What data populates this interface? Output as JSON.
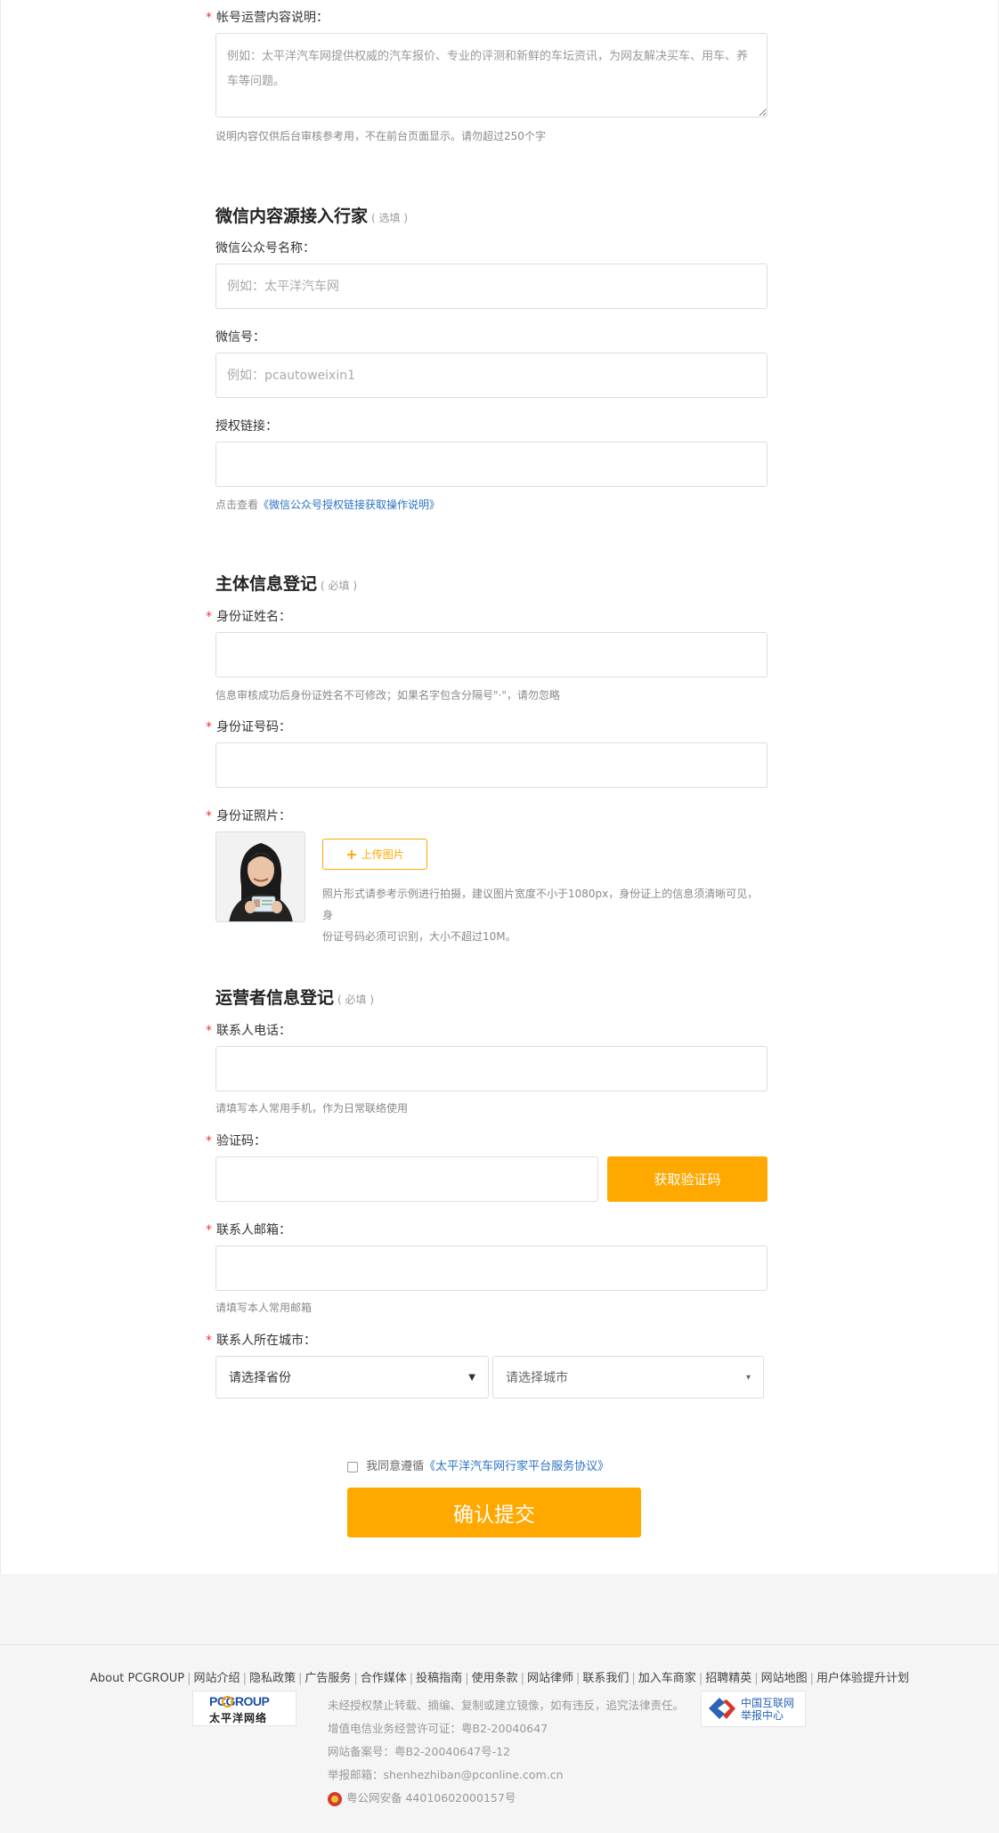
{
  "account_desc": {
    "label": "帐号运营内容说明：",
    "placeholder": "例如：太平洋汽车网提供权威的汽车报价、专业的评测和新鲜的车坛资讯，为网友解决买车、用车、养车等问题。",
    "hint": "说明内容仅供后台审核参考用，不在前台页面显示。请勿超过250个字"
  },
  "wechat": {
    "title": "微信内容源接入行家",
    "note": "( 选填 )",
    "name_label": "微信公众号名称：",
    "name_placeholder": "例如：太平洋汽车网",
    "id_label": "微信号：",
    "id_placeholder": "例如：pcautoweixin1",
    "auth_label": "授权链接：",
    "auth_hint_prefix": "点击查看",
    "auth_hint_link": "《微信公众号授权链接获取操作说明》"
  },
  "subject": {
    "title": "主体信息登记",
    "note": "( 必填 )",
    "idname_label": "身份证姓名：",
    "idname_hint": "信息审核成功后身份证姓名不可修改；如果名字包含分隔号\"·\"，请勿忽略",
    "idnum_label": "身份证号码：",
    "photo_label": "身份证照片：",
    "upload_label": "上传图片",
    "photo_hint_line1": "照片形式请参考示例进行拍摄，建议图片宽度不小于1080px，身份证上的信息须清晰可见，身",
    "photo_hint_line2": "份证号码必须可识别，大小不超过10M。"
  },
  "operator": {
    "title": "运营者信息登记",
    "note": "( 必填 )",
    "phone_label": "联系人电话：",
    "phone_hint": "请填写本人常用手机，作为日常联络使用",
    "code_label": "验证码：",
    "code_button": "获取验证码",
    "email_label": "联系人邮箱：",
    "email_hint": "请填写本人常用邮箱",
    "city_label": "联系人所在城市：",
    "province_select": "请选择省份",
    "city_select": "请选择城市"
  },
  "agreement": {
    "prefix": "我同意遵循",
    "link": "《太平洋汽车网行家平台服务协议》"
  },
  "submit_label": "确认提交",
  "footer": {
    "links": [
      "About PCGROUP",
      "网站介绍",
      "隐私政策",
      "广告服务",
      "合作媒体",
      "投稿指南",
      "使用条款",
      "网站律师",
      "联系我们",
      "加入车商家",
      "招聘精英",
      "网站地图",
      "用户体验提升计划"
    ],
    "logo_top": "PCGROUP",
    "logo_bottom": "太平洋网络",
    "line1": "未经授权禁止转载、摘编、复制或建立镜像，如有违反，追究法律责任。",
    "line2": "增值电信业务经营许可证：粤B2-20040647",
    "line3": "网站备案号：粤B2-20040647号-12",
    "line4": "举报邮箱：shenhezhiban@pconline.com.cn",
    "line5": "粤公网安备 44010602000157号",
    "report_line1": "中国互联网",
    "report_line2": "举报中心"
  },
  "colors": {
    "accent": "#ffa800",
    "link": "#2a72c5",
    "required": "#e4393c"
  }
}
